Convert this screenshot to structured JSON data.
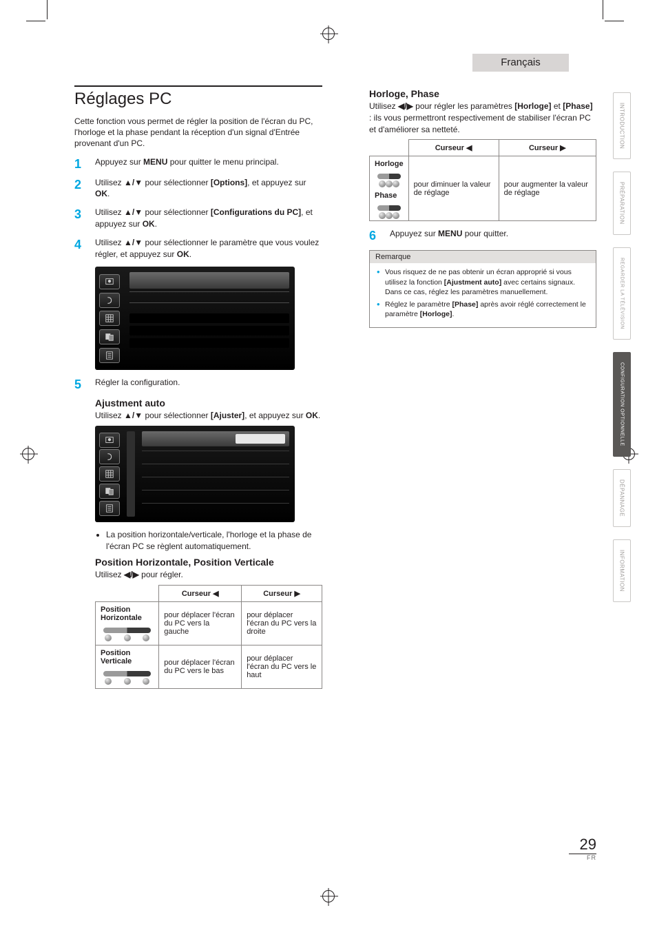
{
  "language_tab": "Français",
  "side_tabs": [
    {
      "label": "INTRODUCTION",
      "active": false
    },
    {
      "label": "PRÉPARATION",
      "active": false
    },
    {
      "label": "REGARDER LA\nTÉLÉVISION",
      "active": false
    },
    {
      "label": "CONFIGURATION\nOPTIONNELLE",
      "active": true
    },
    {
      "label": "DÉPANNAGE",
      "active": false
    },
    {
      "label": "INFORMATION",
      "active": false
    }
  ],
  "title": "Réglages PC",
  "intro": "Cette fonction vous permet de régler la position de l'écran du PC, l'horloge et la phase pendant la réception d'un signal d'Entrée provenant d'un PC.",
  "steps": [
    {
      "num": "1",
      "html": "Appuyez sur <b>MENU</b> pour quitter le menu principal."
    },
    {
      "num": "2",
      "html": "Utilisez <b>▲/▼</b> pour sélectionner <b>[Options]</b>, et appuyez sur <b>OK</b>."
    },
    {
      "num": "3",
      "html": "Utilisez <b>▲/▼</b> pour sélectionner <b>[Configurations du PC]</b>, et appuyez sur <b>OK</b>."
    },
    {
      "num": "4",
      "html": "Utilisez <b>▲/▼</b> pour sélectionner le paramètre que vous voulez régler, et appuyez sur <b>OK</b>."
    },
    {
      "num": "5",
      "html": "Régler la configuration."
    }
  ],
  "section_auto": {
    "heading": "Ajustment auto",
    "text": "Utilisez ▲/▼ pour sélectionner [Ajuster], et appuyez sur OK.",
    "text_bold_pieces": {
      "arrows": "▲/▼",
      "ajuster": "[Ajuster]",
      "ok": "OK"
    },
    "note": "La position horizontale/verticale, l'horloge et la phase de l'écran PC se règlent automatiquement."
  },
  "section_hv": {
    "heading": "Position Horizontale, Position Verticale",
    "text": "Utilisez ◀/▶ pour régler.",
    "table": {
      "header_left": "Curseur ◀",
      "header_right": "Curseur ▶",
      "rows": [
        {
          "label": "Position Horizontale",
          "left": "pour déplacer l'écran du PC vers la gauche",
          "right": "pour déplacer l'écran du PC vers la droite"
        },
        {
          "label": "Position Verticale",
          "left": "pour déplacer l'écran du PC vers le bas",
          "right": "pour déplacer l'écran du PC vers le haut"
        }
      ]
    }
  },
  "section_hp": {
    "heading": "Horloge, Phase",
    "text_prefix": "Utilisez ",
    "text_arrows": "◀/▶",
    "text_mid": " pour régler les paramètres ",
    "text_h": "[Horloge]",
    "text_and": " et ",
    "text_p": "[Phase]",
    "text_suffix": " : ils vous permettront respectivement de stabiliser l'écran PC et d'améliorer sa netteté.",
    "table": {
      "header_left": "Curseur ◀",
      "header_right": "Curseur ▶",
      "rows": [
        {
          "label": "Horloge"
        },
        {
          "label": "Phase"
        }
      ],
      "left_text": "pour diminuer la valeur de réglage",
      "right_text": "pour augmenter la valeur de réglage"
    }
  },
  "step6": {
    "num": "6",
    "html": "Appuyez sur <b>MENU</b> pour quitter."
  },
  "remark": {
    "title": "Remarque",
    "items": [
      "Vous risquez de ne pas obtenir un écran approprié si vous utilisez la fonction [Ajustment auto] avec certains signaux. Dans ce cas, réglez les paramètres manuellement.",
      "Réglez le paramètre [Phase] après avoir réglé correctement le paramètre [Horloge]."
    ],
    "items_bold": {
      "ajustment_auto": "[Ajustment auto]",
      "phase": "[Phase]",
      "horloge": "[Horloge]"
    }
  },
  "page_number": "29",
  "page_lang": "FR"
}
